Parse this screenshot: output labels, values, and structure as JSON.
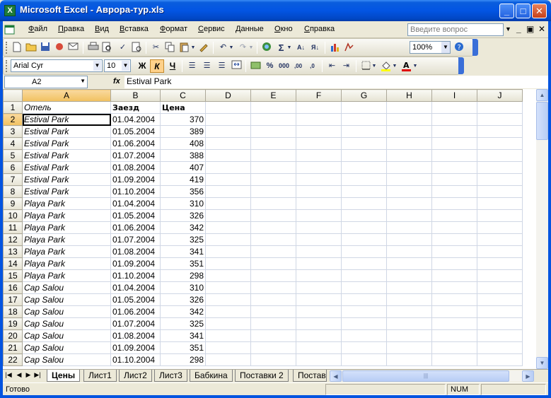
{
  "window": {
    "title": "Microsoft Excel - Аврора-тур.xls"
  },
  "menu": {
    "items": [
      "Файл",
      "Правка",
      "Вид",
      "Вставка",
      "Формат",
      "Сервис",
      "Данные",
      "Окно",
      "Справка"
    ],
    "ask_placeholder": "Введите вопрос"
  },
  "toolbar": {
    "zoom": "100%",
    "font": "Arial Cyr",
    "size": "10"
  },
  "formula_bar": {
    "cell_ref": "A2",
    "fx": "fx",
    "value": "Estival Park"
  },
  "sheet": {
    "columns": [
      "A",
      "B",
      "C",
      "D",
      "E",
      "F",
      "G",
      "H",
      "I",
      "J"
    ],
    "header_row": {
      "row": "1",
      "a": "Отель",
      "b": "Заезд",
      "c": "Цена"
    },
    "rows": [
      {
        "row": "2",
        "hotel": "Estival Park",
        "date": "01.04.2004",
        "price": "370"
      },
      {
        "row": "3",
        "hotel": "Estival Park",
        "date": "01.05.2004",
        "price": "389"
      },
      {
        "row": "4",
        "hotel": "Estival Park",
        "date": "01.06.2004",
        "price": "408"
      },
      {
        "row": "5",
        "hotel": "Estival Park",
        "date": "01.07.2004",
        "price": "388"
      },
      {
        "row": "6",
        "hotel": "Estival Park",
        "date": "01.08.2004",
        "price": "407"
      },
      {
        "row": "7",
        "hotel": "Estival Park",
        "date": "01.09.2004",
        "price": "419"
      },
      {
        "row": "8",
        "hotel": "Estival Park",
        "date": "01.10.2004",
        "price": "356"
      },
      {
        "row": "9",
        "hotel": "Playa Park",
        "date": "01.04.2004",
        "price": "310"
      },
      {
        "row": "10",
        "hotel": "Playa Park",
        "date": "01.05.2004",
        "price": "326"
      },
      {
        "row": "11",
        "hotel": "Playa Park",
        "date": "01.06.2004",
        "price": "342"
      },
      {
        "row": "12",
        "hotel": "Playa Park",
        "date": "01.07.2004",
        "price": "325"
      },
      {
        "row": "13",
        "hotel": "Playa Park",
        "date": "01.08.2004",
        "price": "341"
      },
      {
        "row": "14",
        "hotel": "Playa Park",
        "date": "01.09.2004",
        "price": "351"
      },
      {
        "row": "15",
        "hotel": "Playa Park",
        "date": "01.10.2004",
        "price": "298"
      },
      {
        "row": "16",
        "hotel": "Cap Salou",
        "date": "01.04.2004",
        "price": "310"
      },
      {
        "row": "17",
        "hotel": "Cap Salou",
        "date": "01.05.2004",
        "price": "326"
      },
      {
        "row": "18",
        "hotel": "Cap Salou",
        "date": "01.06.2004",
        "price": "342"
      },
      {
        "row": "19",
        "hotel": "Cap Salou",
        "date": "01.07.2004",
        "price": "325"
      },
      {
        "row": "20",
        "hotel": "Cap Salou",
        "date": "01.08.2004",
        "price": "341"
      },
      {
        "row": "21",
        "hotel": "Cap Salou",
        "date": "01.09.2004",
        "price": "351"
      },
      {
        "row": "22",
        "hotel": "Cap Salou",
        "date": "01.10.2004",
        "price": "298"
      }
    ]
  },
  "tabs": [
    "Цены",
    "Лист1",
    "Лист2",
    "Лист3",
    "Бабкина",
    "Поставки 2",
    "Постав"
  ],
  "status": {
    "text": "Готово",
    "num": "NUM"
  },
  "colors": {
    "title_bar": "#0355e3",
    "selected_header": "#f1c15f",
    "grid_line": "#d0d7e5"
  }
}
